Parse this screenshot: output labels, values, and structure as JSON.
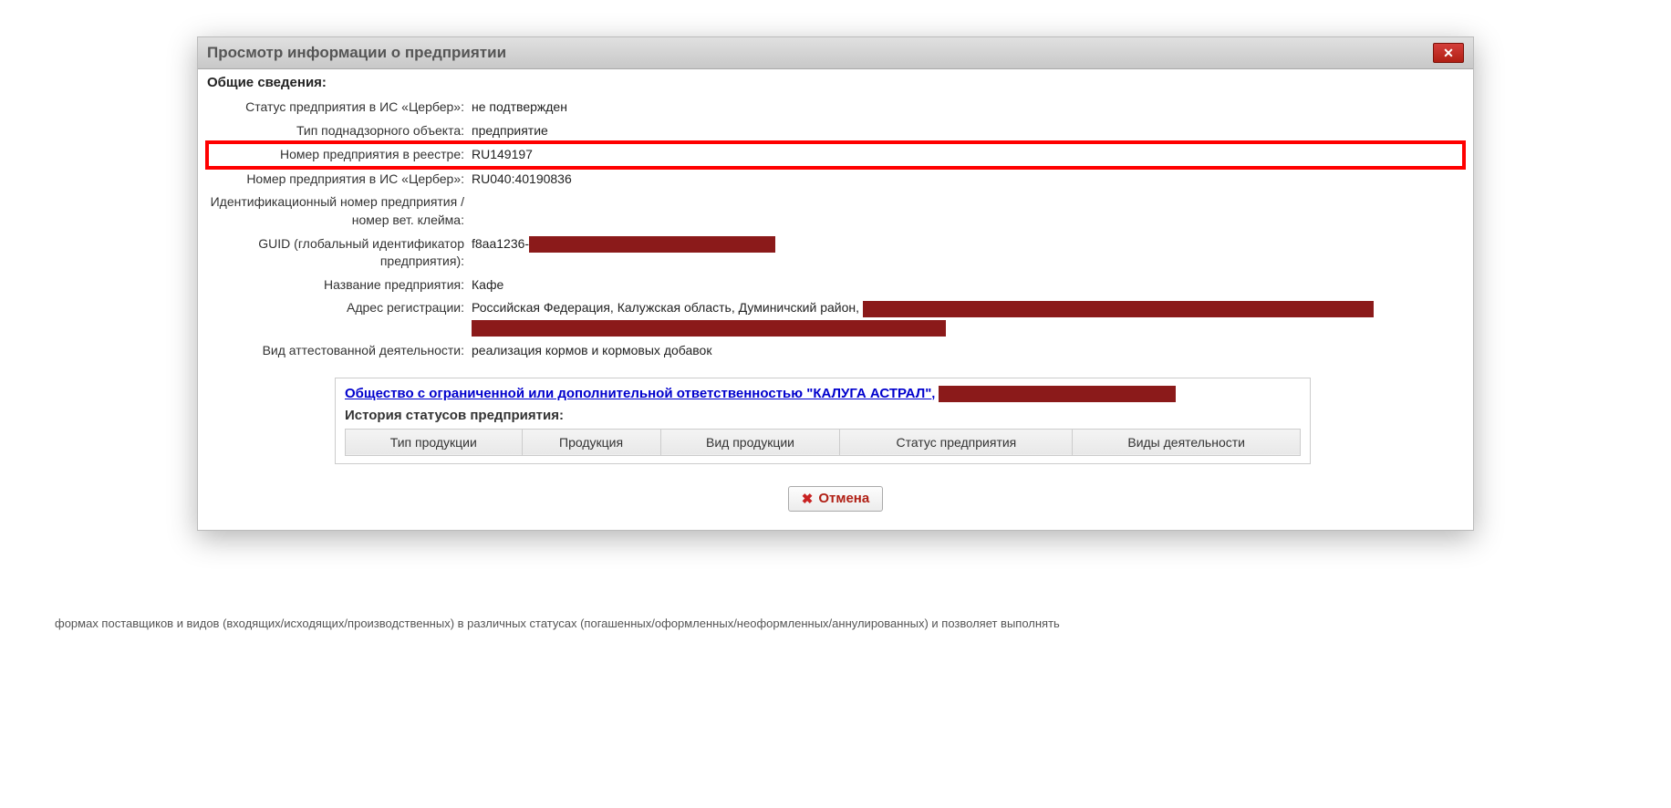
{
  "dialog": {
    "title": "Просмотр информации о предприятии",
    "section": "Общие сведения:",
    "rows": {
      "status_label": "Статус предприятия в ИС «Цербер»:",
      "status_value": "не подтвержден",
      "type_label": "Тип поднадзорного объекта:",
      "type_value": "предприятие",
      "regnum_label": "Номер предприятия в реестре:",
      "regnum_value": "RU149197",
      "cerbnum_label": "Номер предприятия в ИС «Цербер»:",
      "cerbnum_value": "RU040:40190836",
      "ident_label": "Идентификационный номер предприятия / номер вет. клейма:",
      "ident_value": "",
      "guid_label": "GUID (глобальный идентификатор предприятия):",
      "guid_value": "f8aa1236-",
      "name_label": "Название предприятия:",
      "name_value": "Кафе",
      "addr_label": "Адрес регистрации:",
      "addr_value": "Российская Федерация, Калужская область, Думиничский район, ",
      "activity_label": "Вид аттестованной деятельности:",
      "activity_value": "реализация кормов и кормовых добавок"
    },
    "org_link": "Общество с ограниченной или дополнительной ответственностью \"КАЛУГА АСТРАЛ\"",
    "history_header": "История статусов предприятия:",
    "table_headers": {
      "col1": "Тип продукции",
      "col2": "Продукция",
      "col3": "Вид продукции",
      "col4": "Статус предприятия",
      "col5": "Виды деятельности"
    },
    "cancel": "Отмена"
  },
  "background_text": "формах поставщиков и видов (входящих/исходящих/производственных) в различных статусах (погашенных/оформленных/неоформленных/аннулированных) и позволяет выполнять"
}
